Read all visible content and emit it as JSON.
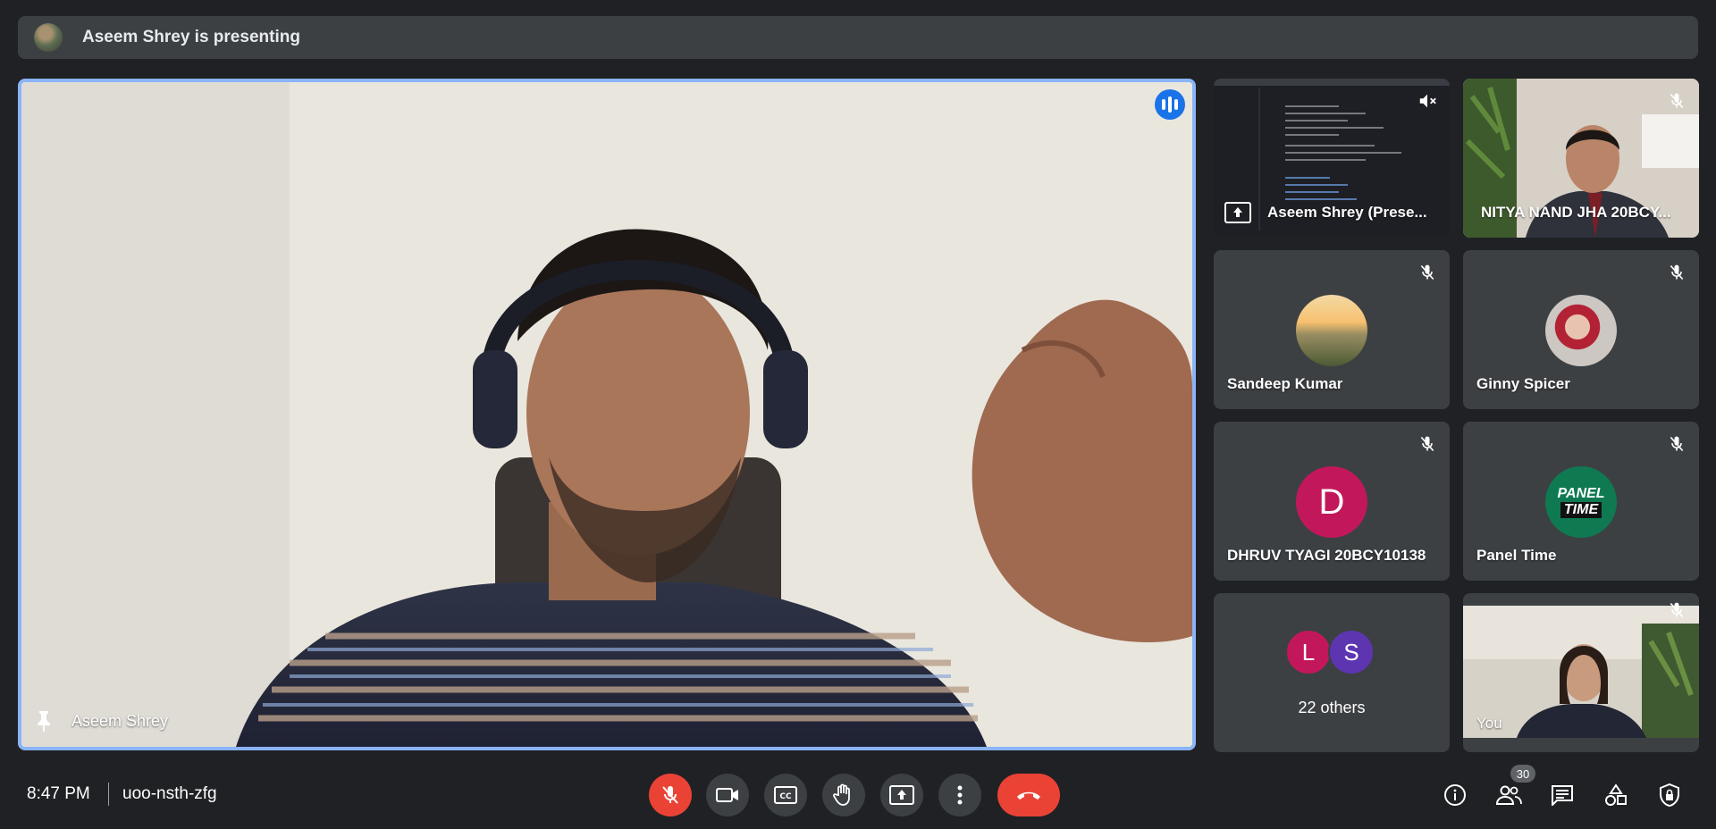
{
  "banner": {
    "text": "Aseem Shrey is presenting"
  },
  "main": {
    "name": "Aseem Shrey"
  },
  "tiles": {
    "presentation": {
      "name": "Aseem Shrey (Prese..."
    },
    "nitya": {
      "name": "NITYA NAND JHA 20BCY..."
    },
    "sandeep": {
      "name": "Sandeep Kumar"
    },
    "ginny": {
      "name": "Ginny Spicer"
    },
    "dhruv": {
      "name": "DHRUV TYAGI 20BCY10138",
      "initial": "D"
    },
    "panel": {
      "name": "Panel Time",
      "logo_line1": "PANEL",
      "logo_line2": "TIME"
    },
    "others": {
      "label": "22 others",
      "initials": [
        "L",
        "S"
      ]
    },
    "you": {
      "name": "You"
    }
  },
  "bottom": {
    "time": "8:47 PM",
    "meeting_code": "uoo-nsth-zfg",
    "participants_count": "30"
  },
  "colors": {
    "accent_blue": "#8ab4f8",
    "speaking_blue": "#1a73e8",
    "danger_red": "#ea4335",
    "dhruv_avatar": "#c2185b",
    "others_L": "#c2185b",
    "others_S": "#5e35b1",
    "panel_green": "#0f7a52"
  }
}
